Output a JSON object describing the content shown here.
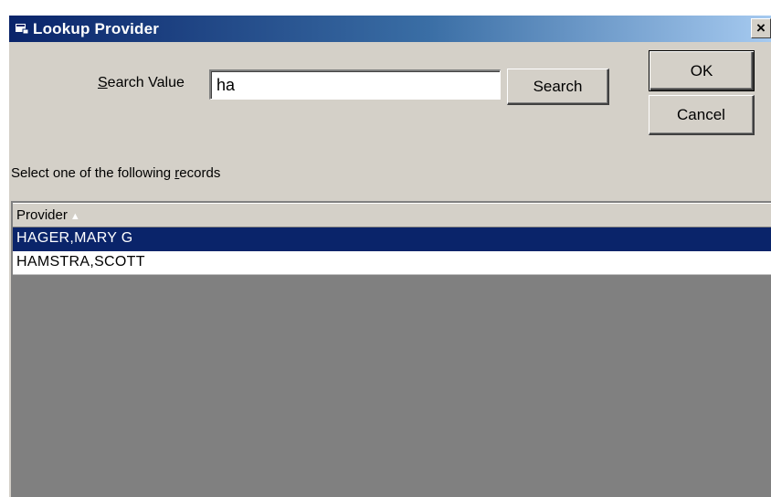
{
  "window": {
    "title": "Lookup Provider",
    "close_glyph": "×"
  },
  "search": {
    "label_accel": "S",
    "label_rest": "earch Value",
    "value": "ha",
    "button_label": "Search"
  },
  "actions": {
    "ok_label": "OK",
    "cancel_label": "Cancel"
  },
  "instructions": {
    "prefix": "Select one of the following ",
    "accel": "r",
    "suffix": "ecords"
  },
  "grid": {
    "column_header": "Provider",
    "sort_indicator": "▲",
    "rows": [
      {
        "name": "HAGER,MARY G",
        "selected": true
      },
      {
        "name": "HAMSTRA,SCOTT",
        "selected": false
      }
    ]
  },
  "colors": {
    "selection": "#0a246a",
    "dialog_face": "#d4d0c8",
    "grid_empty": "#808080"
  }
}
